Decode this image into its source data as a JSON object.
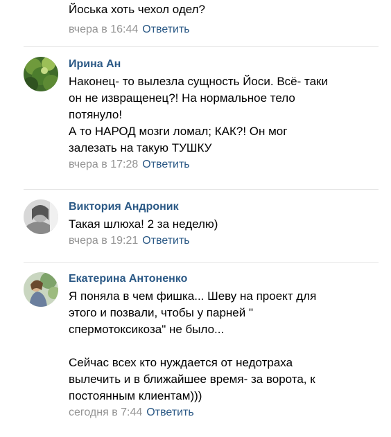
{
  "comments": [
    {
      "author": "",
      "text": "Йоська хоть чехол одел?",
      "time": "вчера в 16:44",
      "reply": "Ответить"
    },
    {
      "author": "Ирина Ан",
      "text": "Наконец- то вылезла сущность Йоси. Всё- таки\nон не извращенец?! На нормальное тело\nпотянуло!\nА то НАРОД мозги ломал; КАК?! Он мог\nзалезать на такую ТУШКУ",
      "time": "вчера в 17:28",
      "reply": "Ответить"
    },
    {
      "author": "Виктория Андроник",
      "text": "Такая шлюха! 2 за неделю)",
      "time": "вчера в 19:21",
      "reply": "Ответить"
    },
    {
      "author": "Екатерина Антоненко",
      "text": "Я поняла в чем фишка... Шеву на проект для\nэтого и позвали, чтобы у парней \"\nспермотоксикоза\" не было...\n\nСейчас всех кто нуждается от недотраха\nвылечить и в ближайшее время- за ворота, к\nпостоянным клиентам)))",
      "time": "сегодня в 7:44",
      "reply": "Ответить"
    }
  ]
}
